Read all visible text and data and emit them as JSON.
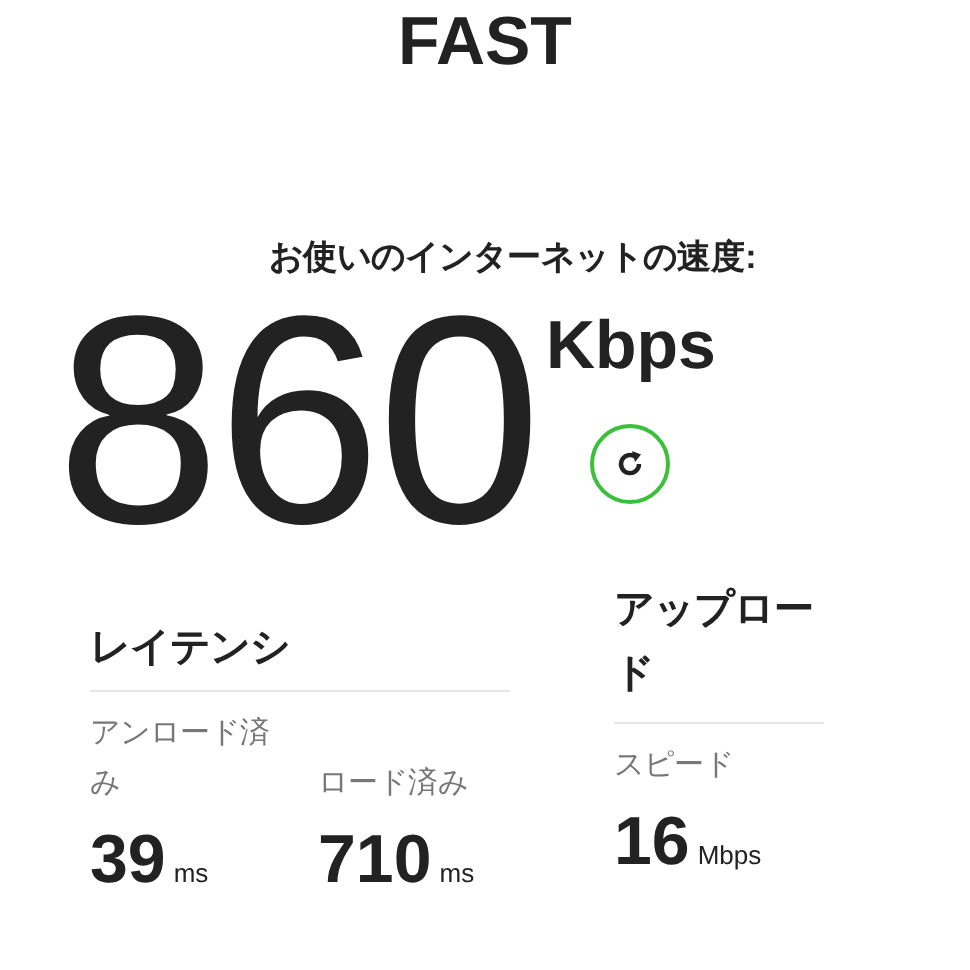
{
  "logo": "FAST",
  "heading": "お使いのインターネットの速度:",
  "speed": {
    "value": "860",
    "unit": "Kbps"
  },
  "latency": {
    "title": "レイテンシ",
    "metrics": [
      {
        "label": "アンロード済み",
        "value": "39",
        "unit": "ms"
      },
      {
        "label": "ロード済み",
        "value": "710",
        "unit": "ms"
      }
    ]
  },
  "upload": {
    "title": "アップロード",
    "metrics": [
      {
        "label": "スピード",
        "value": "16",
        "unit": "Mbps"
      }
    ]
  }
}
